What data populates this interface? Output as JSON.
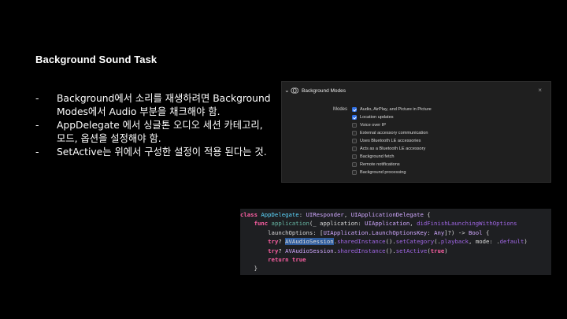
{
  "slide": {
    "title": "Background Sound Task",
    "bullets": [
      {
        "dash": "-",
        "text": "Background에서 소리를 재생하려면 Background Modes에서 Audio 부분을 채크해야 함."
      },
      {
        "dash": "-",
        "text": "AppDelegate 에서 싱글톤 오디오 세션 카테고리, 모드, 옵션을 설정해야 함."
      },
      {
        "dash": "-",
        "text": "SetActive는 위에서 구성한 설정이 적용 된다는 것."
      }
    ]
  },
  "capabilities_panel": {
    "title": "Background Modes",
    "modes_label": "Modes",
    "modes": [
      {
        "label": "Audio, AirPlay, and Picture in Picture",
        "checked": true
      },
      {
        "label": "Location updates",
        "checked": true
      },
      {
        "label": "Voice over IP",
        "checked": false
      },
      {
        "label": "External accessory communication",
        "checked": false
      },
      {
        "label": "Uses Bluetooth LE accessories",
        "checked": false
      },
      {
        "label": "Acts as a Bluetooth LE accessory",
        "checked": false
      },
      {
        "label": "Background fetch",
        "checked": false
      },
      {
        "label": "Remote notifications",
        "checked": false
      },
      {
        "label": "Background processing",
        "checked": false
      }
    ],
    "accent_color": "#2f6fe4"
  },
  "code": {
    "lines": [
      [
        {
          "t": "class ",
          "c": "kw"
        },
        {
          "t": "AppDelegate",
          "c": "ty"
        },
        {
          "t": ": ",
          "c": "pl"
        },
        {
          "t": "UIResponder",
          "c": "tyd"
        },
        {
          "t": ", ",
          "c": "pl"
        },
        {
          "t": "UIApplicationDelegate",
          "c": "tyd"
        },
        {
          "t": " {",
          "c": "pl"
        }
      ],
      [
        {
          "t": "    ",
          "c": "pl"
        },
        {
          "t": "func ",
          "c": "kw"
        },
        {
          "t": "application",
          "c": "fn"
        },
        {
          "t": "(_ application: ",
          "c": "pl"
        },
        {
          "t": "UIApplication",
          "c": "tyd"
        },
        {
          "t": ", ",
          "c": "pl"
        },
        {
          "t": "didFinishLaunchingWithOptions",
          "c": "fnp"
        }
      ],
      [
        {
          "t": "        launchOptions: [",
          "c": "pl"
        },
        {
          "t": "UIApplication",
          "c": "tyd"
        },
        {
          "t": ".",
          "c": "pl"
        },
        {
          "t": "LaunchOptionsKey",
          "c": "tyd"
        },
        {
          "t": ": ",
          "c": "pl"
        },
        {
          "t": "Any",
          "c": "tyd"
        },
        {
          "t": "]?) -> ",
          "c": "pl"
        },
        {
          "t": "Bool",
          "c": "tyd"
        },
        {
          "t": " {",
          "c": "pl"
        }
      ],
      [
        {
          "t": "        ",
          "c": "pl"
        },
        {
          "t": "try",
          "c": "kw"
        },
        {
          "t": "? ",
          "c": "pl"
        },
        {
          "t": "AVAudioSession",
          "c": "hl"
        },
        {
          "t": ".",
          "c": "pl"
        },
        {
          "t": "sharedInstance",
          "c": "fnp"
        },
        {
          "t": "().",
          "c": "pl"
        },
        {
          "t": "setCategory",
          "c": "fnp"
        },
        {
          "t": "(.",
          "c": "pl"
        },
        {
          "t": "playback",
          "c": "fnp"
        },
        {
          "t": ", mode: .",
          "c": "pl"
        },
        {
          "t": "default",
          "c": "fnp"
        },
        {
          "t": ")",
          "c": "pl"
        }
      ],
      [
        {
          "t": "        ",
          "c": "pl"
        },
        {
          "t": "try",
          "c": "kw"
        },
        {
          "t": "? ",
          "c": "pl"
        },
        {
          "t": "AVAudioSession",
          "c": "tyd"
        },
        {
          "t": ".",
          "c": "pl"
        },
        {
          "t": "sharedInstance",
          "c": "fnp"
        },
        {
          "t": "().",
          "c": "pl"
        },
        {
          "t": "setActive",
          "c": "fnp"
        },
        {
          "t": "(",
          "c": "pl"
        },
        {
          "t": "true",
          "c": "kw"
        },
        {
          "t": ")",
          "c": "pl"
        }
      ],
      [
        {
          "t": "        ",
          "c": "pl"
        },
        {
          "t": "return ",
          "c": "kw"
        },
        {
          "t": "true",
          "c": "kw"
        }
      ],
      [
        {
          "t": "    }",
          "c": "pl"
        }
      ]
    ]
  }
}
